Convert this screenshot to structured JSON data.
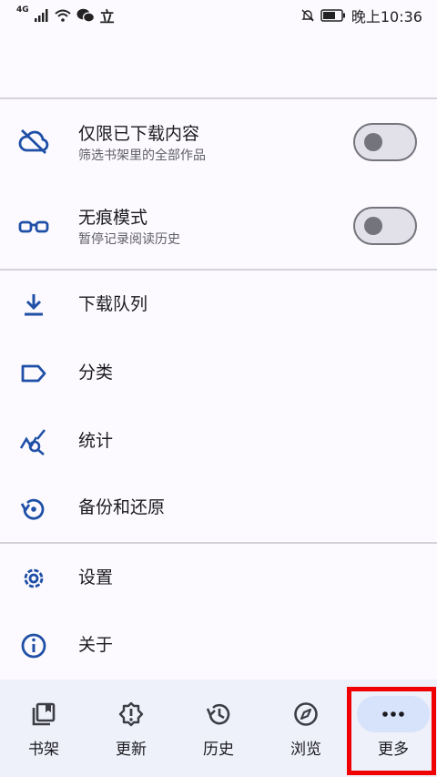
{
  "status_bar": {
    "network": "4G",
    "carrier_glyph": "立",
    "time": "晚上10:36"
  },
  "menu": {
    "downloaded_only": {
      "title": "仅限已下载内容",
      "subtitle": "筛选书架里的全部作品",
      "toggle_on": false
    },
    "incognito": {
      "title": "无痕模式",
      "subtitle": "暂停记录阅读历史",
      "toggle_on": false
    },
    "download_queue": {
      "title": "下载队列"
    },
    "categories": {
      "title": "分类"
    },
    "statistics": {
      "title": "统计"
    },
    "backup_restore": {
      "title": "备份和还原"
    },
    "settings": {
      "title": "设置"
    },
    "about": {
      "title": "关于"
    }
  },
  "bottom_nav": {
    "items": [
      {
        "label": "书架",
        "icon": "library-icon"
      },
      {
        "label": "更新",
        "icon": "updates-icon"
      },
      {
        "label": "历史",
        "icon": "history-icon"
      },
      {
        "label": "浏览",
        "icon": "compass-icon"
      },
      {
        "label": "更多",
        "icon": "more-icon",
        "active": true
      }
    ]
  },
  "colors": {
    "accent": "#1f4fa6",
    "background": "#fcfaff",
    "nav_background": "#eef0fa",
    "active_pill": "#d7e2fb",
    "highlight": "#f00000"
  }
}
